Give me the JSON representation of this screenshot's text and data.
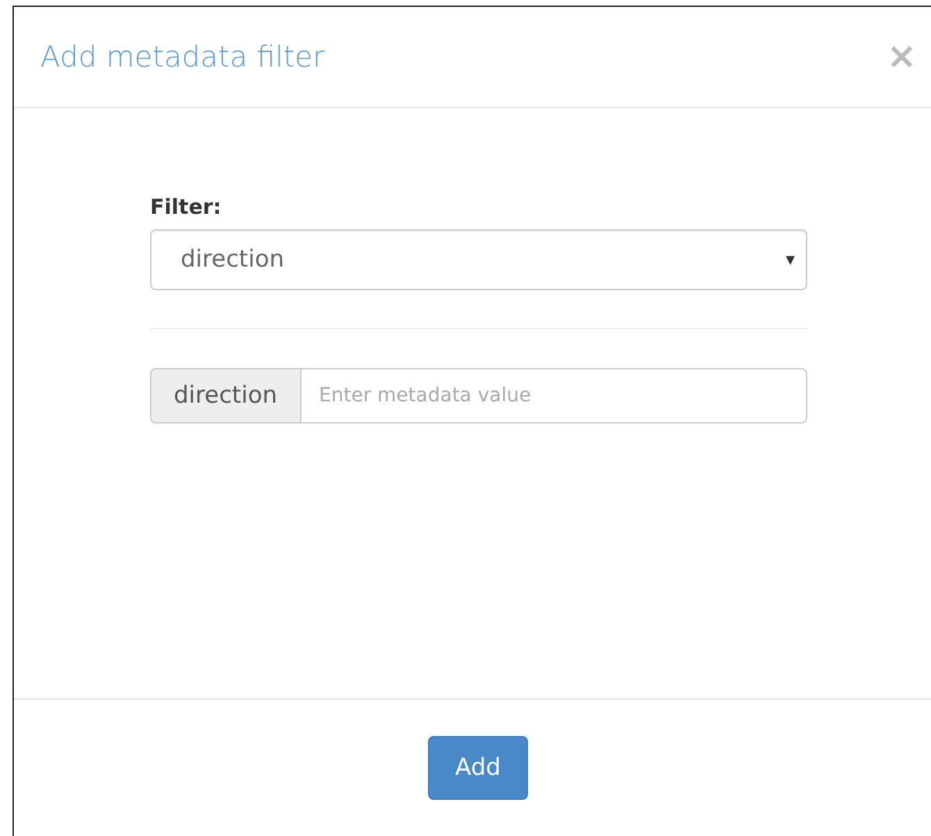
{
  "dialog": {
    "title": "Add metadata filter",
    "close": "×"
  },
  "filter": {
    "label": "Filter:",
    "value": "direction",
    "caret": "▾"
  },
  "metadata": {
    "addon": "direction",
    "placeholder": "Enter metadata value"
  },
  "buttons": [
    "Add"
  ]
}
